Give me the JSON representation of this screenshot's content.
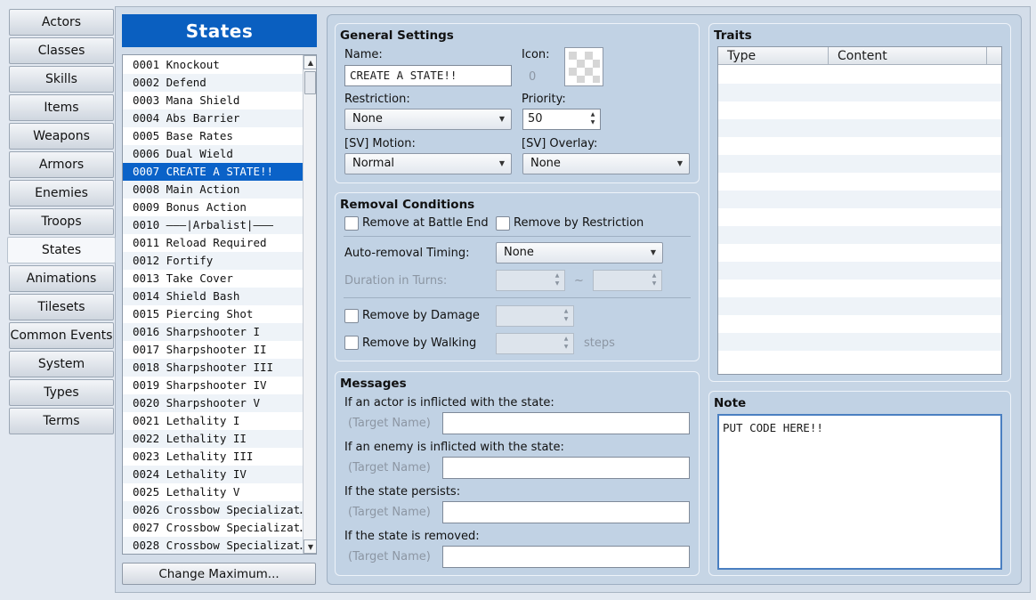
{
  "tabs": [
    {
      "label": "Actors"
    },
    {
      "label": "Classes"
    },
    {
      "label": "Skills"
    },
    {
      "label": "Items"
    },
    {
      "label": "Weapons"
    },
    {
      "label": "Armors"
    },
    {
      "label": "Enemies"
    },
    {
      "label": "Troops"
    },
    {
      "label": "States",
      "active": true
    },
    {
      "label": "Animations"
    },
    {
      "label": "Tilesets"
    },
    {
      "label": "Common Events"
    },
    {
      "label": "System"
    },
    {
      "label": "Types"
    },
    {
      "label": "Terms"
    }
  ],
  "list": {
    "header": "States",
    "selected_index": 6,
    "items": [
      "0001 Knockout",
      "0002 Defend",
      "0003 Mana Shield",
      "0004 Abs Barrier",
      "0005 Base Rates",
      "0006 Dual Wield",
      "0007 CREATE A STATE!!",
      "0008 Main Action",
      "0009 Bonus Action",
      "0010 ———|Arbalist|———",
      "0011 Reload Required",
      "0012 Fortify",
      "0013 Take Cover",
      "0014 Shield Bash",
      "0015 Piercing Shot",
      "0016 Sharpshooter I",
      "0017 Sharpshooter II",
      "0018 Sharpshooter III",
      "0019 Sharpshooter IV",
      "0020 Sharpshooter V",
      "0021 Lethality I",
      "0022 Lethality II",
      "0023 Lethality III",
      "0024 Lethality IV",
      "0025 Lethality V",
      "0026 Crossbow Specializat…",
      "0027 Crossbow Specializat…",
      "0028 Crossbow Specializat…"
    ],
    "change_max_label": "Change Maximum..."
  },
  "general": {
    "title": "General Settings",
    "name_label": "Name:",
    "name_value": "CREATE A STATE!!",
    "icon_label": "Icon:",
    "icon_index": "0",
    "restriction_label": "Restriction:",
    "restriction_value": "None",
    "priority_label": "Priority:",
    "priority_value": "50",
    "sv_motion_label": "[SV] Motion:",
    "sv_motion_value": "Normal",
    "sv_overlay_label": "[SV] Overlay:",
    "sv_overlay_value": "None"
  },
  "removal": {
    "title": "Removal Conditions",
    "battle_end_label": "Remove at Battle End",
    "restriction_label": "Remove by Restriction",
    "auto_timing_label": "Auto-removal Timing:",
    "auto_timing_value": "None",
    "duration_label": "Duration in Turns:",
    "tilde": "~",
    "damage_label": "Remove by Damage",
    "walking_label": "Remove by Walking",
    "steps_label": "steps"
  },
  "messages": {
    "title": "Messages",
    "actor_label": "If an actor is inflicted with the state:",
    "enemy_label": "If an enemy is inflicted with the state:",
    "persists_label": "If the state persists:",
    "removed_label": "If the state is removed:",
    "target_name": "(Target Name)"
  },
  "traits": {
    "title": "Traits",
    "col_type": "Type",
    "col_content": "Content"
  },
  "note": {
    "title": "Note",
    "value": "PUT CODE HERE!!"
  },
  "colors": {
    "accent": "#0a5fc0",
    "selected_row": "#0a62c8",
    "panel_bg": "#c6d5e5"
  }
}
